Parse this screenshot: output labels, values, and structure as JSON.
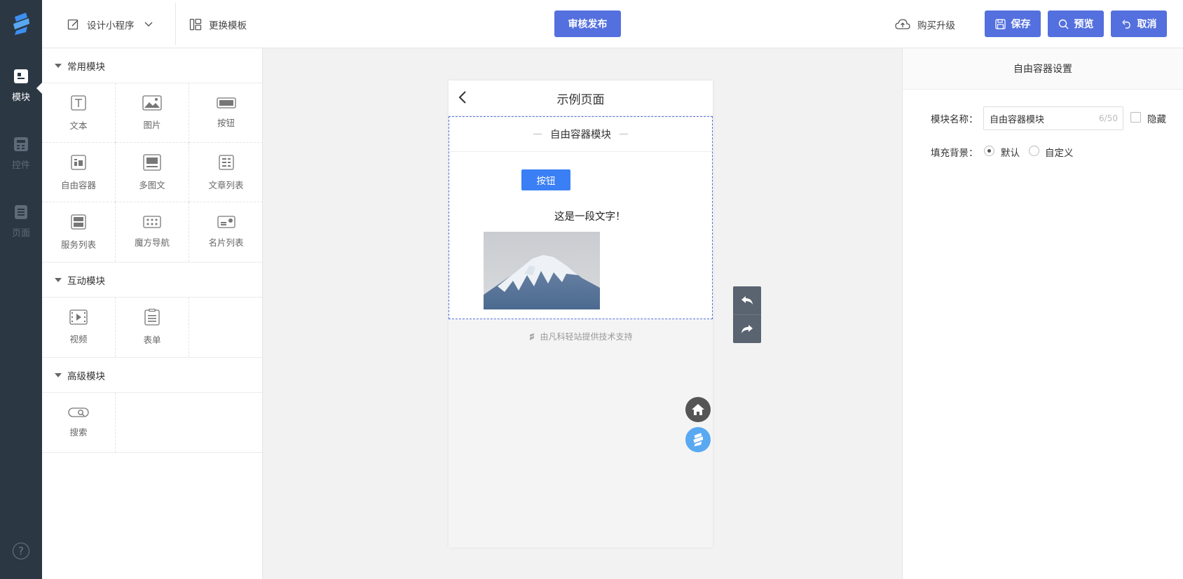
{
  "rail": {
    "items": [
      {
        "label": "模块"
      },
      {
        "label": "控件"
      },
      {
        "label": "页面"
      }
    ],
    "help": "?"
  },
  "topbar": {
    "design_label": "设计小程序",
    "template_label": "更换模板",
    "publish_label": "审核发布",
    "upgrade_label": "购买升级",
    "save_label": "保存",
    "preview_label": "预览",
    "cancel_label": "取消"
  },
  "modules": {
    "common": {
      "title": "常用模块",
      "items": [
        "文本",
        "图片",
        "按钮",
        "自由容器",
        "多图文",
        "文章列表",
        "服务列表",
        "魔方导航",
        "名片列表"
      ]
    },
    "interactive": {
      "title": "互动模块",
      "items": [
        "视频",
        "表单"
      ]
    },
    "advanced": {
      "title": "高级模块",
      "items": [
        "搜索"
      ]
    }
  },
  "phone": {
    "title": "示例页面",
    "container_title": "自由容器模块",
    "button_label": "按钮",
    "text": "这是一段文字！",
    "support": "由凡科轻站提供技术支持"
  },
  "settings": {
    "title": "自由容器设置",
    "name_label": "模块名称：",
    "name_value": "自由容器模块",
    "name_counter": "6/50",
    "hide_label": "隐藏",
    "bg_label": "填充背景：",
    "bg_options": [
      "默认",
      "自定义"
    ],
    "bg_selected": "默认"
  },
  "colors": {
    "primary": "#5470de",
    "rail_bg": "#2c3744",
    "inner_button": "#3a7ff5"
  }
}
